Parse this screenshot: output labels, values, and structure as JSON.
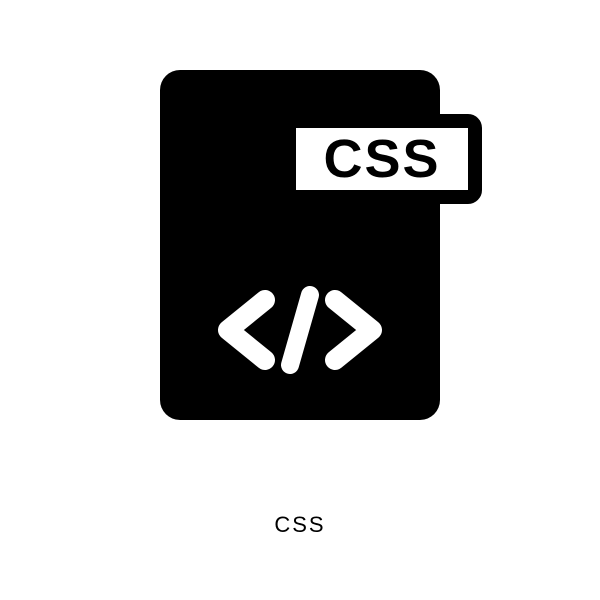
{
  "icon": {
    "badge_text": "CSS",
    "caption": "CSS",
    "semantic_name": "css-file-icon"
  },
  "colors": {
    "foreground": "#000000",
    "background": "#ffffff"
  }
}
